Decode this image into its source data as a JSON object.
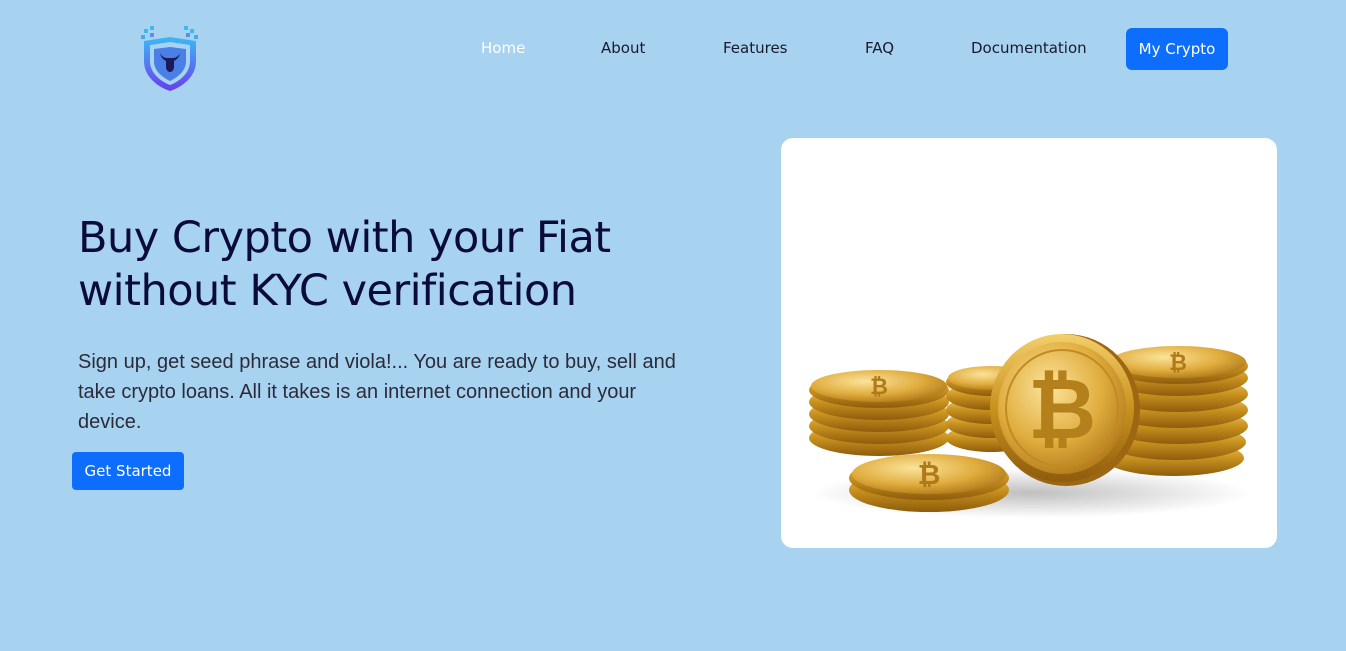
{
  "brand": {
    "logo_icon": "bull-shield-logo-icon",
    "colors": {
      "background": "#a7d2f0",
      "primary": "#0d6efd",
      "heading": "#0b0b3b",
      "nav_active": "#ffffff"
    }
  },
  "nav": {
    "items": [
      {
        "label": "Home",
        "active": true
      },
      {
        "label": "About"
      },
      {
        "label": "Features"
      },
      {
        "label": "FAQ"
      },
      {
        "label": "Documentation"
      }
    ],
    "cta_label": "My Crypto"
  },
  "hero": {
    "title_line1": "Buy Crypto with your Fiat",
    "title_line2": "without KYC verification",
    "description": "Sign up, get seed phrase and viola!... You are ready to buy, sell and take crypto loans. All it takes is an internet connection and your device.",
    "button_label": "Get Started",
    "image_icon": "bitcoin-coins-icon"
  }
}
